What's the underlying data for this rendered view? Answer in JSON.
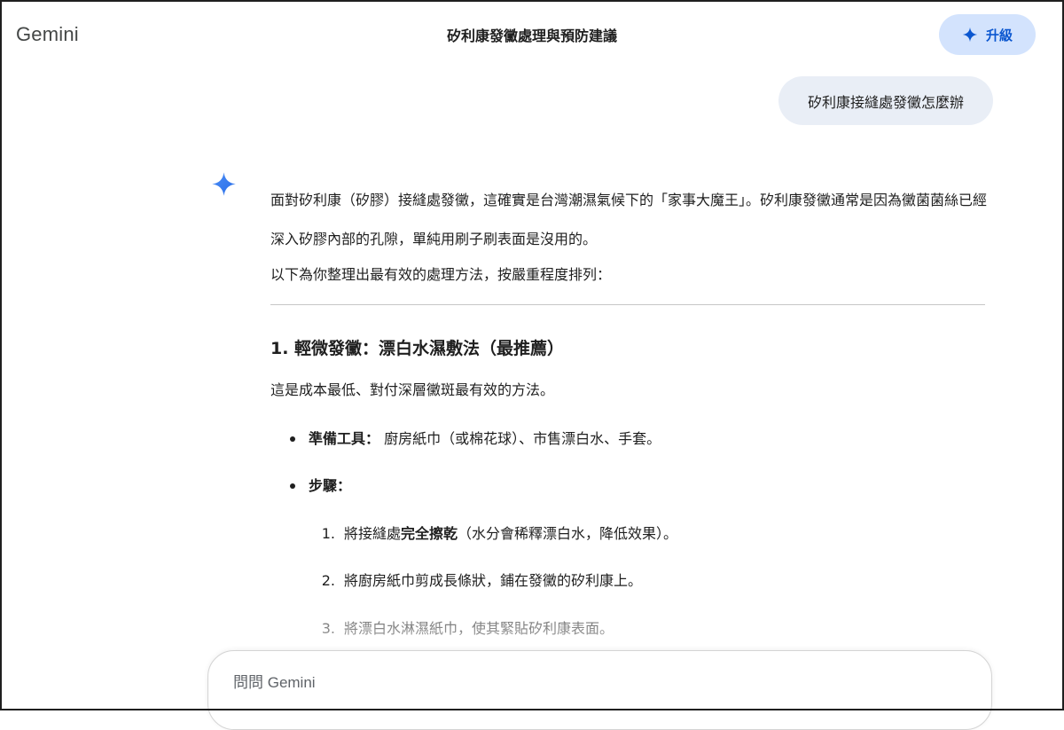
{
  "header": {
    "brand": "Gemini",
    "conversation_title": "矽利康發黴處理與預防建議",
    "upgrade_label": "升級",
    "upgrade_icon": "sparkle-icon"
  },
  "user_message": "矽利康接縫處發黴怎麼辦",
  "response": {
    "avatar_icon": "gemini-sparkle-icon",
    "intro": "面對矽利康（矽膠）接縫處發黴，這確實是台灣潮濕氣候下的「家事大魔王」。矽利康發黴通常是因為黴菌菌絲已經深入矽膠內部的孔隙，單純用刷子刷表面是沒用的。",
    "lead": "以下為你整理出最有效的處理方法，按嚴重程度排列：",
    "section": {
      "heading": "1. 輕微發黴：漂白水濕敷法（最推薦）",
      "summary": "這是成本最低、對付深層黴斑最有效的方法。",
      "bullets": [
        {
          "label": "準備工具：",
          "text": " 廚房紙巾（或棉花球）、市售漂白水、手套。"
        },
        {
          "label": "步驟：",
          "text": ""
        }
      ],
      "steps": [
        {
          "num": "1.",
          "pre": "將接縫處",
          "bold": "完全擦乾",
          "post": "（水分會稀釋漂白水，降低效果）。"
        },
        {
          "num": "2.",
          "pre": "將廚房紙巾剪成長條狀，鋪在發黴的矽利康上。",
          "bold": "",
          "post": ""
        },
        {
          "num": "3.",
          "pre": "將漂白水淋濕紙巾，使其緊貼矽利康表面。",
          "bold": "",
          "post": ""
        }
      ]
    }
  },
  "composer": {
    "placeholder": "問問 Gemini",
    "value": ""
  },
  "colors": {
    "upgrade_bg": "#d3e3fd",
    "upgrade_text": "#0b57d0",
    "user_bubble_bg": "#e9eef6",
    "accent_gradient_start": "#4285f4",
    "accent_gradient_end": "#1a73e8"
  }
}
